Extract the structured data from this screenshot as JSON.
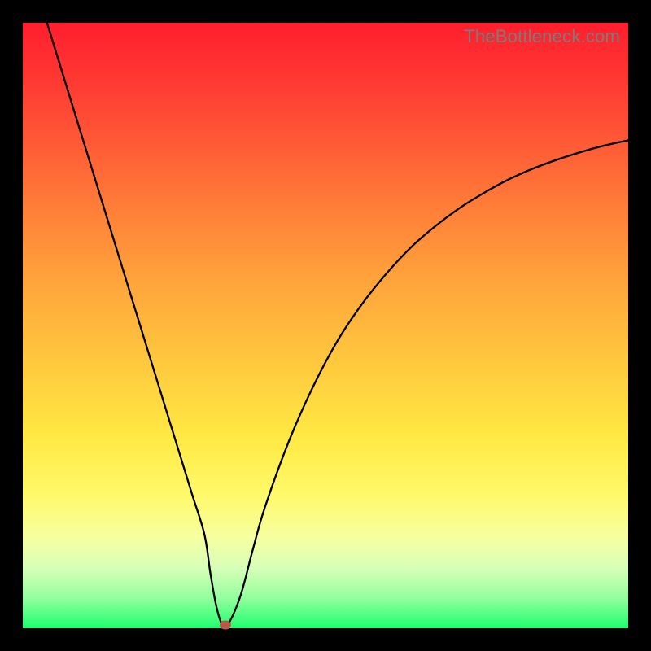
{
  "watermark": "TheBottleneck.com",
  "colors": {
    "frame": "#000000",
    "curve_stroke": "#000000",
    "marker": "#b55a4a",
    "watermark_text": "#7c7c7c",
    "gradient_top": "#ff1e2d",
    "gradient_bottom": "#1fff6f"
  },
  "chart_data": {
    "type": "line",
    "title": "",
    "xlabel": "",
    "ylabel": "",
    "xlim": [
      0,
      100
    ],
    "ylim": [
      0,
      100
    ],
    "x": [
      4,
      6,
      8,
      10,
      12,
      14,
      16,
      18,
      20,
      22,
      24,
      26,
      28,
      30,
      31,
      32,
      33,
      34,
      36,
      38,
      40,
      44,
      48,
      52,
      56,
      60,
      64,
      68,
      72,
      76,
      80,
      84,
      88,
      92,
      96,
      100
    ],
    "y": [
      100,
      93.5,
      87,
      80.5,
      74,
      67.5,
      61,
      54.5,
      48,
      41.5,
      35,
      28.5,
      22,
      15.5,
      9,
      3.5,
      0.5,
      0.8,
      5.5,
      13,
      20,
      31,
      40,
      47.5,
      53.5,
      58.5,
      62.8,
      66.3,
      69.3,
      71.8,
      74,
      75.8,
      77.3,
      78.6,
      79.7,
      80.6
    ],
    "marker": {
      "x": 33.5,
      "y": 0.6
    },
    "grid": false,
    "legend": false
  }
}
